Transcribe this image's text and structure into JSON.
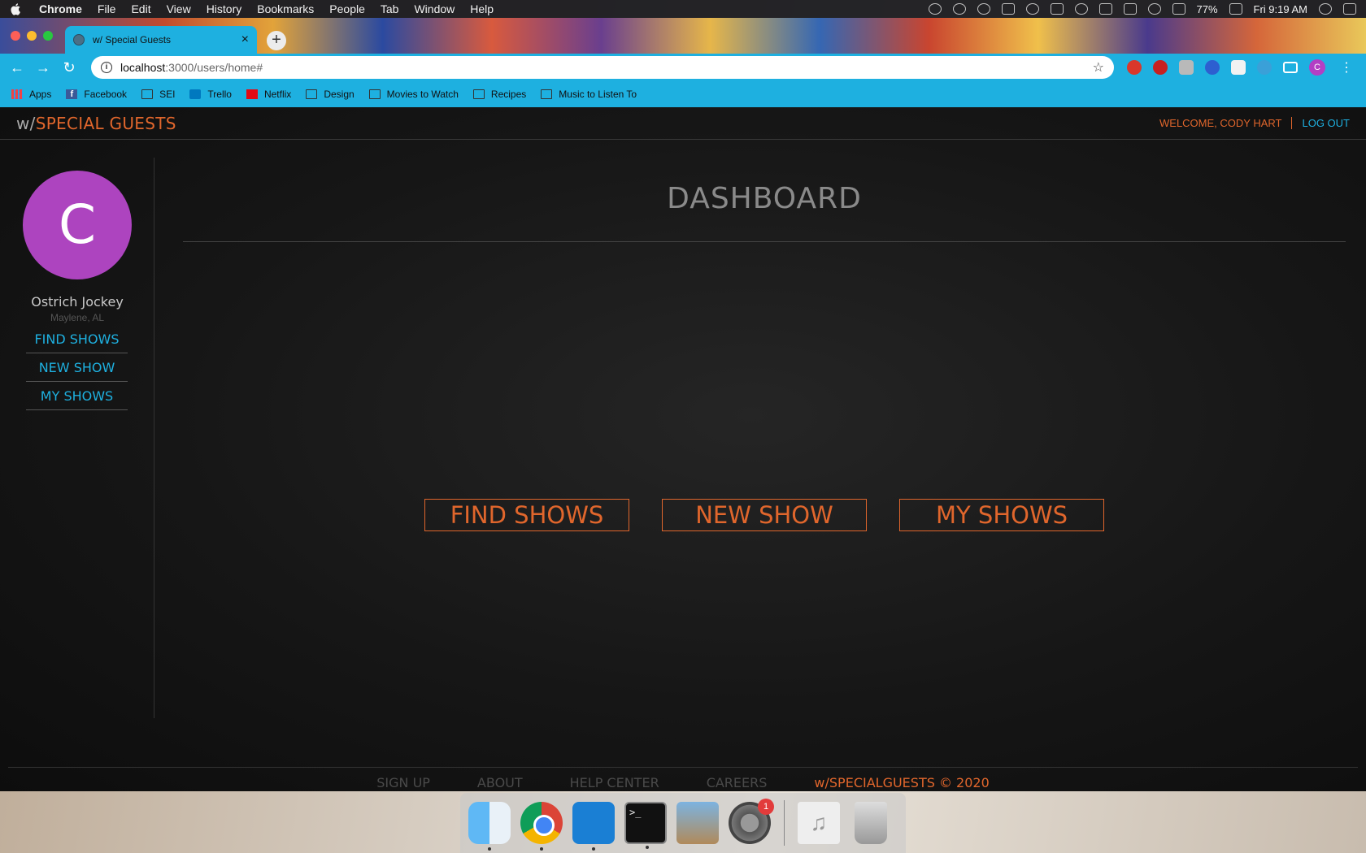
{
  "menubar": {
    "app": "Chrome",
    "items": [
      "File",
      "Edit",
      "View",
      "History",
      "Bookmarks",
      "People",
      "Tab",
      "Window",
      "Help"
    ],
    "battery": "77%",
    "clock": "Fri 9:19 AM"
  },
  "browser": {
    "tab_title": "w/ Special Guests",
    "url_host": "localhost",
    "url_path": ":3000/users/home#",
    "bookmarks": [
      "Apps",
      "Facebook",
      "SEI",
      "Trello",
      "Netflix",
      "Design",
      "Movies to Watch",
      "Recipes",
      "Music to Listen To"
    ],
    "profile_initial": "C"
  },
  "header": {
    "brand_prefix": "w/",
    "brand_name": "SPECIAL GUESTS",
    "welcome": "WELCOME, CODY HART",
    "logout": "LOG OUT"
  },
  "sidebar": {
    "avatar_initial": "C",
    "user_name": "Ostrich Jockey",
    "user_location": "Maylene, AL",
    "links": [
      "FIND SHOWS",
      "NEW SHOW",
      "MY SHOWS"
    ]
  },
  "main": {
    "title": "DASHBOARD",
    "buttons": [
      "FIND SHOWS",
      "NEW SHOW",
      "MY SHOWS"
    ]
  },
  "footer": {
    "links": [
      "SIGN UP",
      "ABOUT",
      "HELP CENTER",
      "CAREERS"
    ],
    "copyright": "w/SPECIALGUESTS © 2020"
  },
  "dock": {
    "prefs_badge": "1"
  },
  "colors": {
    "accent_orange": "#e0662c",
    "accent_blue": "#1eb0e0",
    "avatar_purple": "#ad44bf"
  }
}
